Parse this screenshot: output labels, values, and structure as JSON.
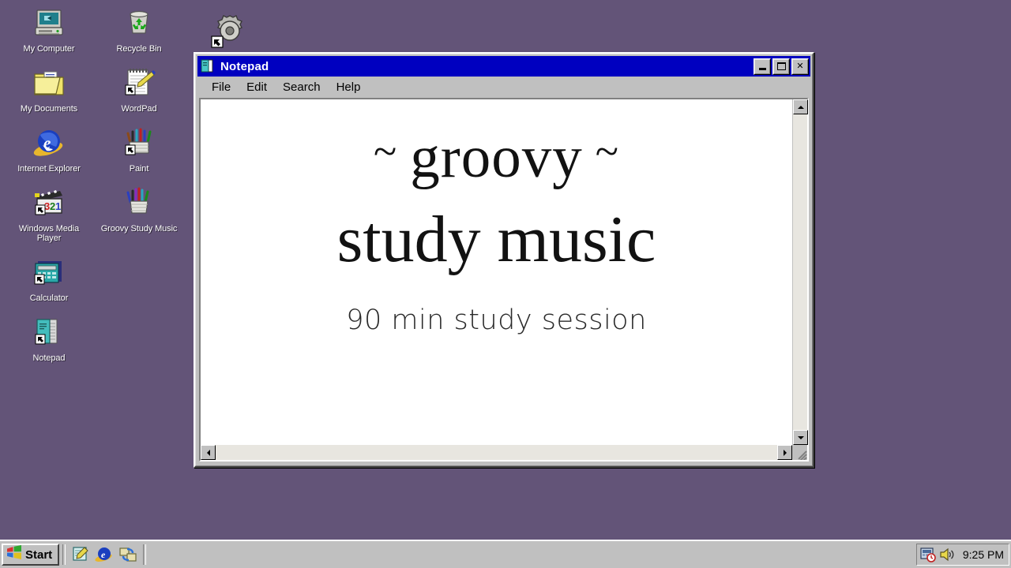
{
  "desktop": {
    "background_color": "#635478",
    "icons_left": [
      {
        "label": "My Computer",
        "icon": "my-computer-icon"
      },
      {
        "label": "My\nDocuments",
        "icon": "my-documents-icon"
      },
      {
        "label": "Internet\nExplorer",
        "icon": "internet-explorer-icon"
      },
      {
        "label": "Windows\nMedia Player",
        "icon": "windows-media-player-icon"
      },
      {
        "label": "Calculator",
        "icon": "calculator-icon"
      },
      {
        "label": "Notepad",
        "icon": "notepad-icon"
      }
    ],
    "icons_right": [
      {
        "label": "Recycle Bin",
        "icon": "recycle-bin-icon"
      },
      {
        "label": "WordPad",
        "icon": "wordpad-icon"
      },
      {
        "label": "Paint",
        "icon": "paint-icon"
      },
      {
        "label": "Groovy\nStudy Music",
        "icon": "paint-pens-icon"
      }
    ],
    "floating_shortcut": {
      "label": "",
      "icon": "gear-settings-icon"
    }
  },
  "window": {
    "title": "Notepad",
    "title_icon": "notepad-document-icon",
    "titlebar_color": "#0000c0",
    "controls": {
      "minimize": "minimize-icon",
      "maximize": "maximize-icon",
      "close": "close-icon",
      "close_label": "✕"
    },
    "menu": [
      {
        "label": "File"
      },
      {
        "label": "Edit"
      },
      {
        "label": "Search"
      },
      {
        "label": "Help"
      }
    ],
    "content": {
      "line1_left_ornament": "~",
      "line1_text": "groovy",
      "line1_right_ornament": "~",
      "line2_text": "study music",
      "subtitle": "90 min study session"
    },
    "scrollbars": {
      "vertical_up": "scroll-up-arrow-icon",
      "vertical_down": "scroll-down-arrow-icon",
      "horizontal_left": "scroll-left-arrow-icon",
      "horizontal_right": "scroll-right-arrow-icon",
      "resize_grip": "resize-grip-icon"
    }
  },
  "taskbar": {
    "start_label": "Start",
    "start_icon": "windows-logo-icon",
    "quick_launch": [
      {
        "name": "show-desktop-icon"
      },
      {
        "name": "internet-explorer-icon"
      },
      {
        "name": "network-icon"
      }
    ],
    "tray": {
      "icons": [
        {
          "name": "task-scheduler-icon"
        },
        {
          "name": "volume-icon"
        }
      ],
      "clock": "9:25 PM"
    }
  }
}
